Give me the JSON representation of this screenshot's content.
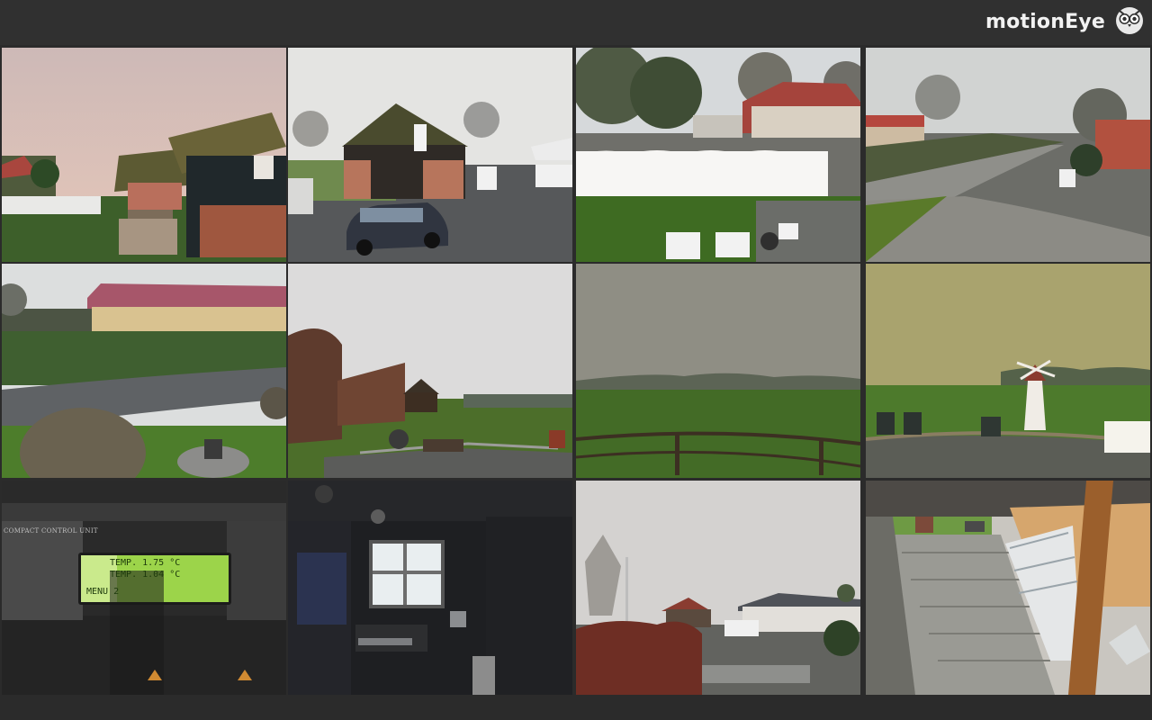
{
  "app": {
    "title": "motionEye",
    "logo_icon": "owl-icon"
  },
  "colors": {
    "header_bg": "#303030",
    "page_bg": "#2b2b2b",
    "brand_text": "#f2f2f2"
  },
  "cameras": [
    {
      "label": "",
      "time": "",
      "scene": "thatched-farmhouse"
    },
    {
      "label": "",
      "time": "",
      "scene": "barn-and-car"
    },
    {
      "label": "",
      "time": "",
      "scene": "white-fence-garden"
    },
    {
      "label": "",
      "time": "",
      "scene": "country-road"
    },
    {
      "label": "",
      "time": "",
      "scene": "road-and-hedge"
    },
    {
      "label": "",
      "time": "",
      "scene": "garden-hedge-shed"
    },
    {
      "label": "",
      "time": "",
      "scene": "foggy-field"
    },
    {
      "label": "",
      "time": "",
      "scene": "windmill-lawn"
    },
    {
      "label": "",
      "time": "",
      "scene": "control-unit-display"
    },
    {
      "label": "",
      "time": "",
      "scene": "dark-room-window"
    },
    {
      "label": "",
      "time": "",
      "scene": "street-houses"
    },
    {
      "label": "",
      "time": "",
      "scene": "patio-fisheye"
    }
  ],
  "control_unit": {
    "brand_text": "COMPACT CONTROL UNIT",
    "line1": "TEMP.  1.75 °C",
    "line2": "TEMP.  1.04 °C",
    "line3": "MENU 2"
  }
}
